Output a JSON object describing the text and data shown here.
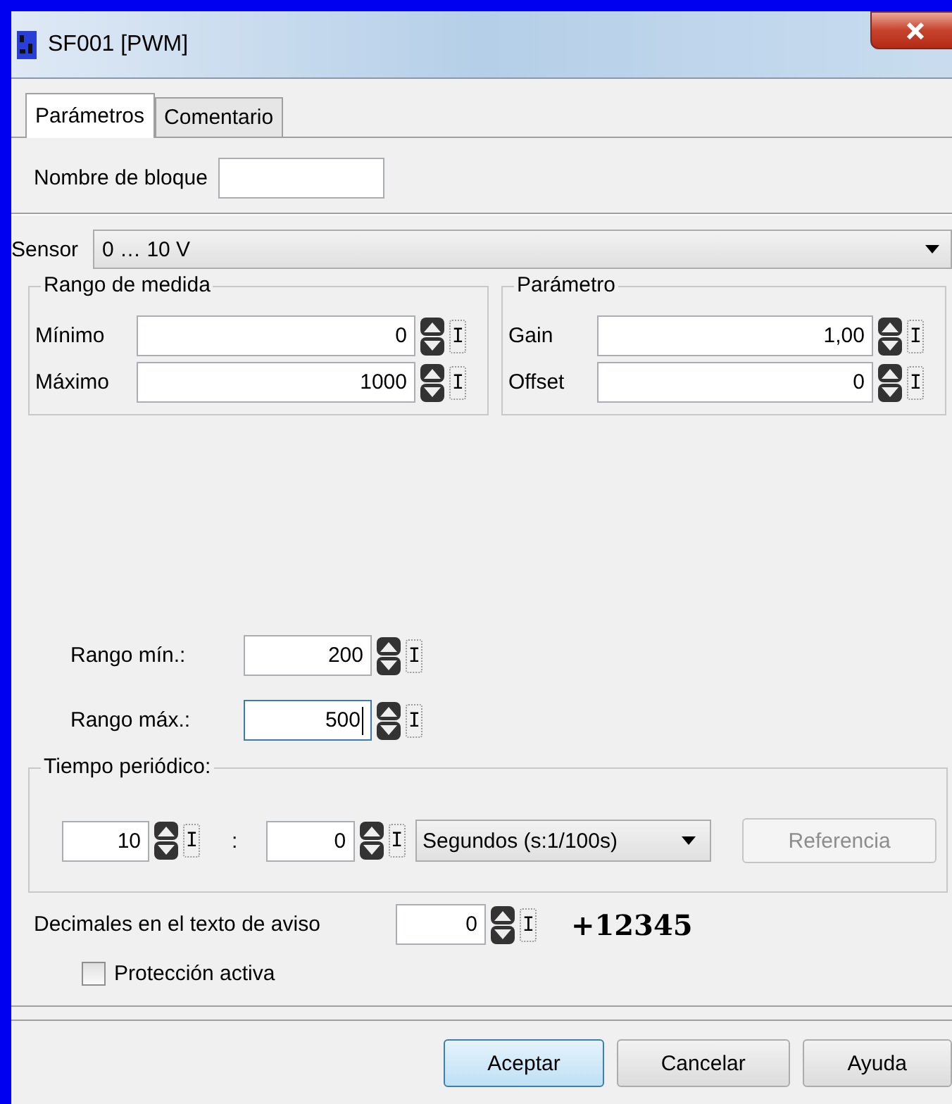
{
  "window": {
    "title": "SF001 [PWM]"
  },
  "tabs": [
    {
      "label": "Parámetros",
      "selected": true
    },
    {
      "label": "Comentario",
      "selected": false
    }
  ],
  "block_name": {
    "label": "Nombre de bloque"
  },
  "sensor": {
    "label": "Sensor",
    "value": "0 … 10 V"
  },
  "measure_range": {
    "title": "Rango de medida",
    "fields": [
      {
        "label": "Mínimo",
        "value": "0",
        "ref": "I",
        "focused": false
      },
      {
        "label": "Máximo",
        "value": "1000",
        "ref": "I",
        "focused": false
      }
    ]
  },
  "parameter": {
    "title": "Parámetro",
    "fields": [
      {
        "label": "Gain",
        "value": "1,00",
        "ref": "I",
        "focused": false
      },
      {
        "label": "Offset",
        "value": "0",
        "ref": "I",
        "focused": false
      }
    ]
  },
  "range_fields": [
    {
      "label": "Rango mín.:",
      "value": "200",
      "ref": "I",
      "focused": false
    },
    {
      "label": "Rango máx.:",
      "value": "500",
      "ref": "I",
      "focused": true
    }
  ],
  "period": {
    "title": "Tiempo periódico:",
    "fields": [
      {
        "value": "10",
        "ref": "I",
        "focused": false
      },
      {
        "value": "0",
        "ref": "I",
        "focused": false
      }
    ],
    "separator": ":",
    "unit": "Segundos (s:1/100s)",
    "reference_button": {
      "label": "Referencia",
      "disabled": true
    }
  },
  "decimals": {
    "label": "Decimales en el texto de aviso",
    "value": "0",
    "ref": "I",
    "focused": false,
    "preview": "+12345"
  },
  "protection": {
    "label": "Protección activa",
    "checked": false
  },
  "buttons": [
    {
      "label": "Aceptar",
      "default": true
    },
    {
      "label": "Cancelar",
      "default": false
    },
    {
      "label": "Ayuda",
      "default": false
    }
  ]
}
